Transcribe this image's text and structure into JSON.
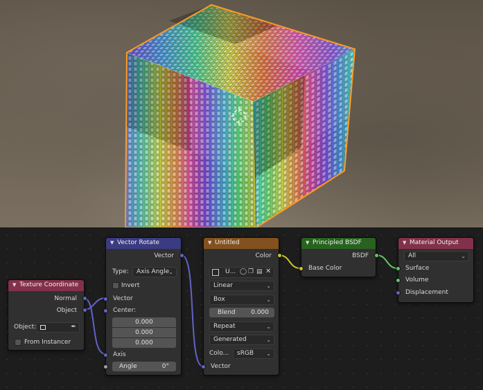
{
  "colors": {
    "header_texture_coordinate": "#83314a",
    "header_vector_rotate": "#3b3b82",
    "header_image_texture": "#83511f",
    "header_principled": "#27631f",
    "header_material_output": "#83314a",
    "socket_vector": "#6363c7",
    "socket_color": "#c7c729",
    "socket_shader": "#63c763",
    "socket_float": "#a1a1a1",
    "selection_outline": "#ff9b23"
  },
  "nodes": {
    "texture_coordinate": {
      "title": "Texture Coordinate",
      "outputs": [
        "Normal",
        "Object"
      ],
      "object_label": "Object:",
      "from_instancer": "From Instancer"
    },
    "vector_rotate": {
      "title": "Vector Rotate",
      "output": "Vector",
      "type_label": "Type:",
      "type_value": "Axis Angle",
      "invert": "Invert",
      "inputs": [
        "Vector",
        "Center:",
        "Axis",
        "Angle"
      ],
      "center_values": [
        "0.000",
        "0.000",
        "0.000"
      ],
      "angle_value": "0°"
    },
    "image_texture": {
      "title": "Untitled",
      "output": "Color",
      "image_name": "U...",
      "interpolation": "Linear",
      "projection": "Box",
      "blend_label": "Blend",
      "blend_value": "0.000",
      "extension": "Repeat",
      "source": "Generated",
      "colorspace_label": "Colo...",
      "colorspace_value": "sRGB",
      "input": "Vector"
    },
    "principled_bsdf": {
      "title": "Principled BSDF",
      "output": "BSDF",
      "input": "Base Color"
    },
    "material_output": {
      "title": "Material Output",
      "target": "All",
      "inputs": [
        "Surface",
        "Volume",
        "Displacement"
      ]
    }
  }
}
